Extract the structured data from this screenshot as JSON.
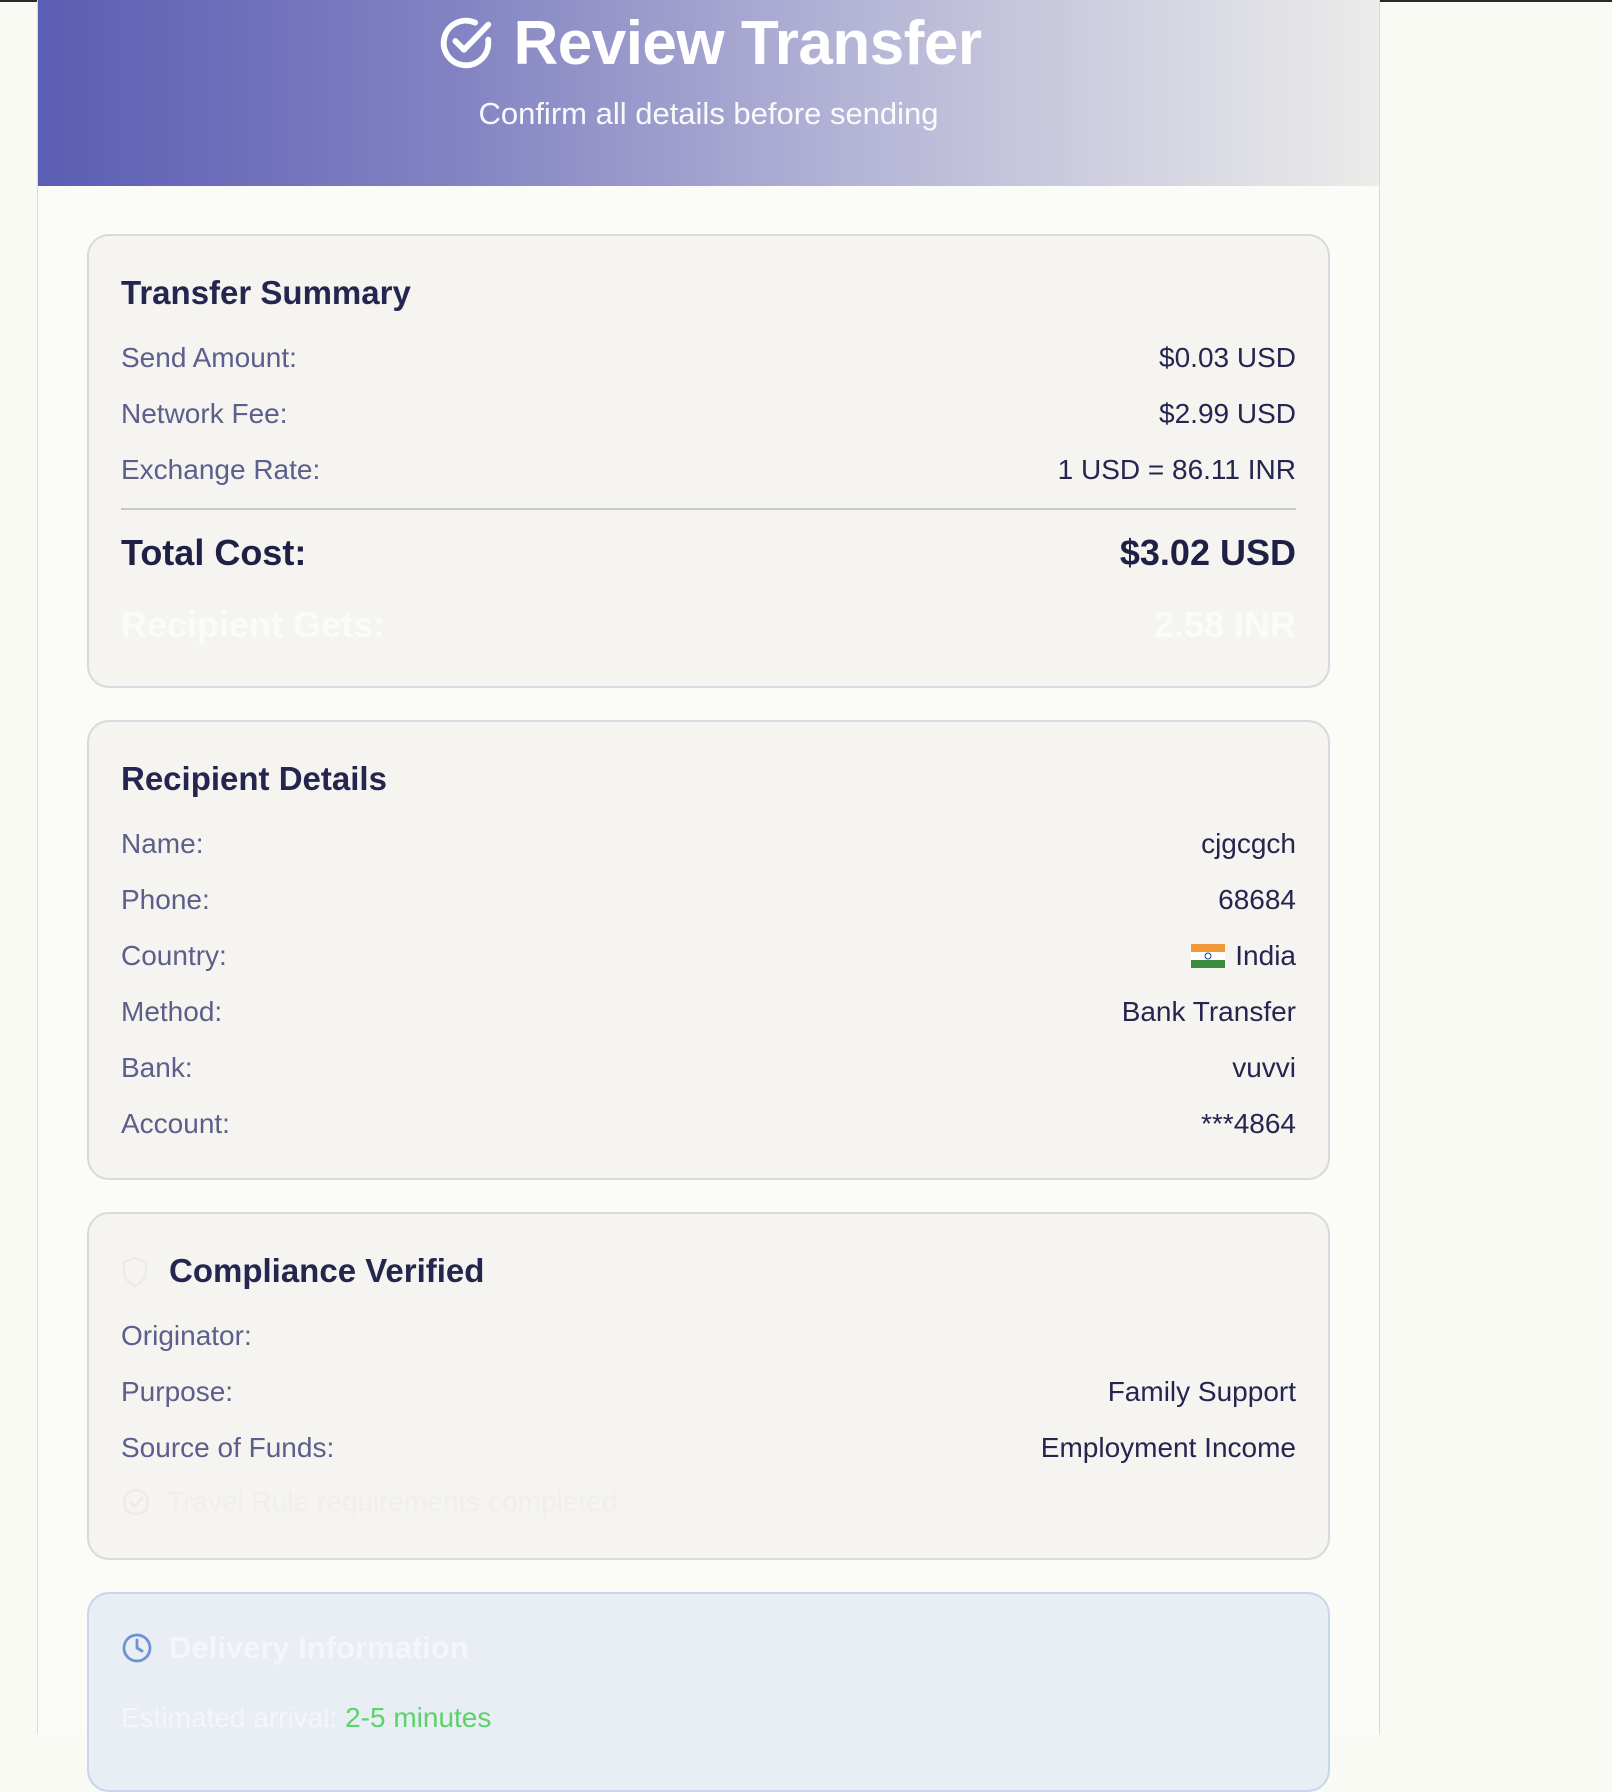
{
  "header": {
    "title": "Review Transfer",
    "subtitle": "Confirm all details before sending",
    "icon": "check-circle-icon"
  },
  "summary": {
    "title": "Transfer Summary",
    "rows": [
      {
        "label": "Send Amount:",
        "value": "$0.03 USD"
      },
      {
        "label": "Network Fee:",
        "value": "$2.99 USD"
      },
      {
        "label": "Exchange Rate:",
        "value": "1 USD = 86.11 INR"
      }
    ],
    "total": {
      "label": "Total Cost:",
      "value": "$3.02 USD"
    },
    "recipient_gets": {
      "label": "Recipient Gets:",
      "value": "2.58 INR"
    }
  },
  "recipient": {
    "title": "Recipient Details",
    "rows": [
      {
        "label": "Name:",
        "value": "cjgcgch"
      },
      {
        "label": "Phone:",
        "value": "68684"
      },
      {
        "label": "Country:",
        "value": "India",
        "flag": "india-flag-icon"
      },
      {
        "label": "Method:",
        "value": "Bank Transfer"
      },
      {
        "label": "Bank:",
        "value": "vuvvi"
      },
      {
        "label": "Account:",
        "value": "***4864"
      }
    ]
  },
  "compliance": {
    "title": "Compliance Verified",
    "icon": "shield-icon",
    "rows": [
      {
        "label": "Originator:",
        "value": ""
      },
      {
        "label": "Purpose:",
        "value": "Family Support"
      },
      {
        "label": "Source of Funds:",
        "value": "Employment Income"
      }
    ],
    "travel_rule": "Travel Rule requirements completed"
  },
  "delivery": {
    "title": "Delivery Information",
    "icon": "clock-icon",
    "arrival_label": "Estimated arrival:",
    "arrival_value": "2-5 minutes",
    "accent_color": "#5ad36a"
  },
  "colors": {
    "header_gradient_start": "#5b5db3",
    "header_gradient_end": "#ececea",
    "text_dark": "#25264f",
    "text_label": "#5c5e8c",
    "card_bg": "#f5f4f0"
  }
}
